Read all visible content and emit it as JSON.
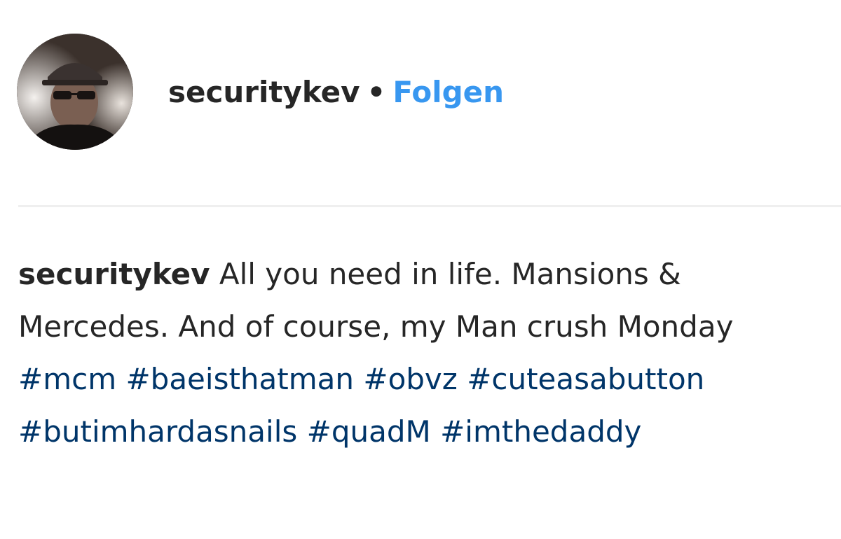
{
  "post": {
    "username": "securitykev",
    "separator": "•",
    "follow_label": "Folgen",
    "avatar_icon": "profile-photo",
    "colors": {
      "follow": "#3897f0",
      "hashtag": "#003569",
      "text": "#262626",
      "divider": "#efefef"
    }
  },
  "caption": {
    "username": "securitykev",
    "text": "All you need in life. Mansions & Mercedes. And of course, my Man crush Monday",
    "hashtags": [
      "#mcm",
      "#baeisthatman",
      "#obvz",
      "#cuteasabutton",
      "#butimhardasnails",
      "#quadM",
      "#imthedaddy"
    ]
  }
}
